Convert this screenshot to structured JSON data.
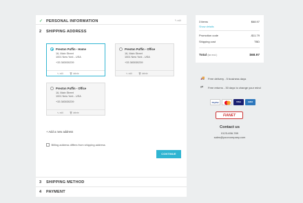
{
  "steps": {
    "personal": {
      "label": "PERSONAL INFORMATION",
      "edit": "edit"
    },
    "shipping_address": {
      "number": "2",
      "label": "SHIPPING ADDRESS"
    },
    "shipping_method": {
      "number": "3",
      "label": "SHIPPING METHOD"
    },
    "payment": {
      "number": "4",
      "label": "PAYMENT"
    }
  },
  "addresses": [
    {
      "title": "Preston Puffin - Home",
      "street": "16, Main Street",
      "city": "1001 New York - USA",
      "phone": "+33 383030239",
      "edit": "edit",
      "delete": "delete",
      "selected": true
    },
    {
      "title": "Preston Puffin - Office",
      "street": "16, Main Street",
      "city": "1001 New York - USA",
      "phone": "+33 383030239",
      "edit": "edit",
      "delete": "delete",
      "selected": false
    },
    {
      "title": "Preston Puffin - Office",
      "street": "16, Main Street",
      "city": "1001 New York - USA",
      "phone": "+33 383030239",
      "edit": "edit",
      "delete": "delete",
      "selected": false
    }
  ],
  "add_address": "Add a new address",
  "billing_checkbox": "Billing address differs from shipping address",
  "continue_label": "CONTINUE",
  "summary": {
    "items_label": "3 items",
    "items_value": "$68.97",
    "show_details": "Show details",
    "promotion_label": "Promotion code",
    "promotion_value": "-$11.79",
    "shipping_label": "Shipping cost",
    "shipping_value": "TBD",
    "total_label": "Total",
    "total_tax": "(tax excl.)",
    "total_value": "$68.97"
  },
  "reassurance": {
    "delivery": "Free delivery - 5 business days",
    "returns": "Free returns - 30 days to change your mind"
  },
  "payments": {
    "paypal": "PayPal",
    "visa": "VISA",
    "amex": "AMEX",
    "fianet": "FIANET"
  },
  "contact": {
    "title": "Contact us",
    "phone": "0123-456-789",
    "email": "sales@yourcompany.com"
  },
  "colors": {
    "accent": "#2fb5d2",
    "check": "#4cbb6c",
    "background": "#eceeef"
  }
}
